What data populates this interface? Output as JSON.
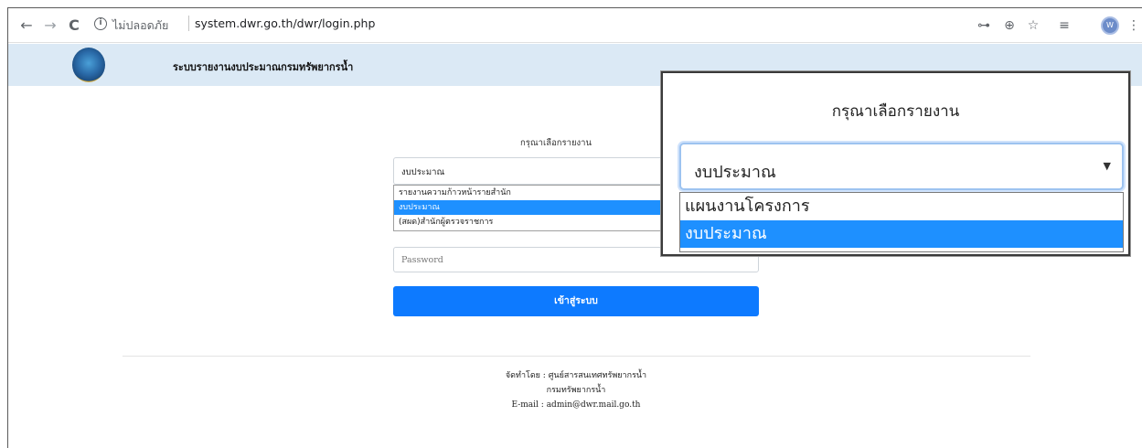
{
  "browser": {
    "back_icon": "←",
    "forward_icon": "→",
    "reload_icon": "C",
    "info_icon": "i",
    "security_label": "ไม่ปลอดภัย",
    "url": "system.dwr.go.th/dwr/login.php",
    "key_icon": "⊶",
    "zoom_icon": "⊕",
    "star_icon": "☆",
    "reading_list_icon": "≡",
    "avatar_initial": "W",
    "menu_icon": "⋮"
  },
  "header": {
    "title": "ระบบรายงานงบประมาณกรมทรัพยากรน้ำ"
  },
  "form": {
    "report_label": "กรุณาเลือกรายงาน",
    "selected_report": "งบประมาณ",
    "options": [
      {
        "label": "รายงานความก้าวหน้ารายสำนัก",
        "selected": false
      },
      {
        "label": "งบประมาณ",
        "selected": true
      },
      {
        "label": "(สผด)สำนักผู้ตรวจราชการ",
        "selected": false
      }
    ],
    "password_placeholder": "Password",
    "login_label": "เข้าสู่ระบบ"
  },
  "footer": {
    "line1": "จัดทำโดย : ศูนย์สารสนเทศทรัพยากรน้ำ",
    "line2": "กรมทรัพยากรน้ำ",
    "line3": "E-mail : admin@dwr.mail.go.th"
  },
  "zoom_callout": {
    "title": "กรุณาเลือกรายงาน",
    "selected_report": "งบประมาณ",
    "arrow": "▼",
    "options": [
      {
        "label": "แผนงานโครงการ",
        "selected": false
      },
      {
        "label": "งบประมาณ",
        "selected": true
      }
    ]
  },
  "colors": {
    "header_bg": "#dbe9f5",
    "primary_button": "#0d7aff",
    "selected_option": "#1e90ff"
  }
}
